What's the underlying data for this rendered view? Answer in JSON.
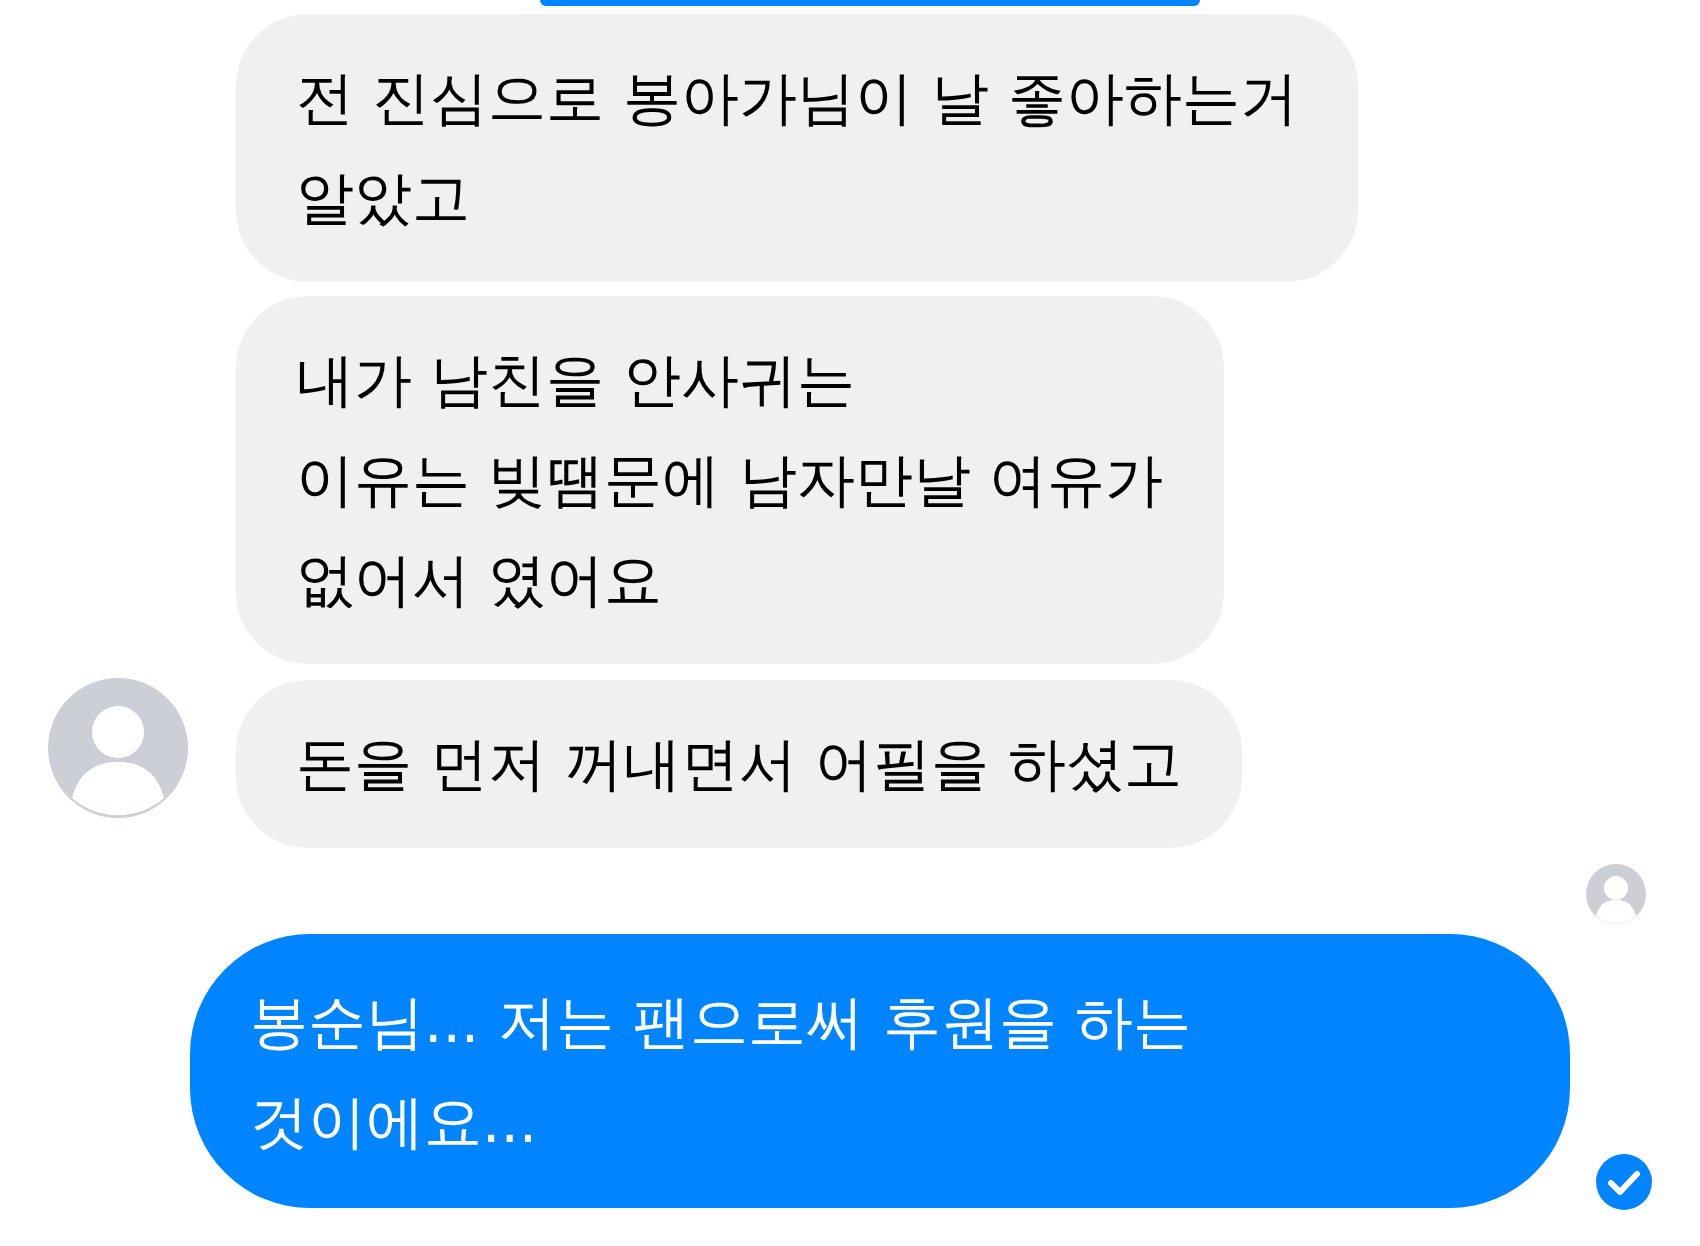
{
  "messages": [
    {
      "kind": "incoming",
      "text": "전 진심으로 봉아가님이 날 좋아하는거\n알았고",
      "avatar": false
    },
    {
      "kind": "incoming",
      "text": "내가 남친을 안사귀는\n이유는 빚땜문에 남자만날 여유가\n없어서 였어요",
      "avatar": false
    },
    {
      "kind": "incoming",
      "text": "돈을 먼저 꺼내면서 어필을 하셨고",
      "avatar": true
    },
    {
      "kind": "seen"
    },
    {
      "kind": "outgoing",
      "text": "봉순님... 저는 팬으로써 후원을 하는\n것이에요...",
      "delivered": true
    }
  ]
}
